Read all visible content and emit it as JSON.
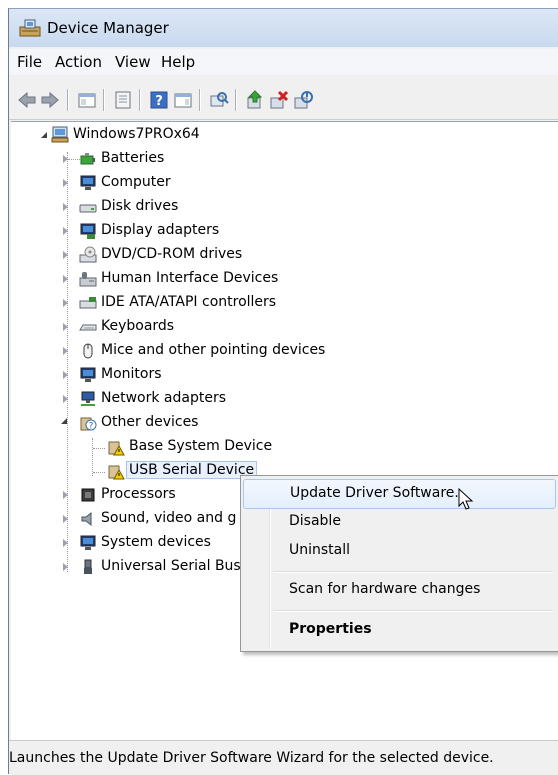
{
  "window": {
    "title": "Device Manager"
  },
  "menu": [
    "File",
    "Action",
    "View",
    "Help"
  ],
  "toolbar": {
    "buttons": [
      "back-icon",
      "forward-icon",
      "show-hide-console-tree-icon",
      "properties-icon",
      "help-icon",
      "action-pane-icon",
      "scan-hardware-icon",
      "update-driver-icon",
      "uninstall-icon",
      "enable-icon"
    ]
  },
  "tree": {
    "root": "Windows7PROx64",
    "categories": [
      {
        "label": "Batteries",
        "icon": "battery-icon"
      },
      {
        "label": "Computer",
        "icon": "computer-icon"
      },
      {
        "label": "Disk drives",
        "icon": "disk-drive-icon"
      },
      {
        "label": "Display adapters",
        "icon": "display-adapter-icon"
      },
      {
        "label": "DVD/CD-ROM drives",
        "icon": "dvd-drive-icon"
      },
      {
        "label": "Human Interface Devices",
        "icon": "hid-icon"
      },
      {
        "label": "IDE ATA/ATAPI controllers",
        "icon": "ide-controller-icon"
      },
      {
        "label": "Keyboards",
        "icon": "keyboard-icon"
      },
      {
        "label": "Mice and other pointing devices",
        "icon": "mouse-icon"
      },
      {
        "label": "Monitors",
        "icon": "monitor-icon"
      },
      {
        "label": "Network adapters",
        "icon": "network-adapter-icon"
      },
      {
        "label": "Other devices",
        "icon": "unknown-device-icon"
      },
      {
        "label": "Processors",
        "icon": "processor-icon"
      },
      {
        "label": "Sound, video and g",
        "icon": "sound-icon"
      },
      {
        "label": "System devices",
        "icon": "system-devices-icon"
      },
      {
        "label": "Universal Serial Bus",
        "icon": "usb-icon"
      }
    ],
    "other_devices_children": [
      {
        "label": "Base System Device",
        "icon": "warning-device-icon"
      },
      {
        "label": "USB Serial Device",
        "icon": "warning-device-icon"
      }
    ]
  },
  "context_menu": {
    "items": [
      "Update Driver Software...",
      "Disable",
      "Uninstall",
      "Scan for hardware changes",
      "Properties"
    ]
  },
  "status": "Launches the Update Driver Software Wizard for the selected device."
}
